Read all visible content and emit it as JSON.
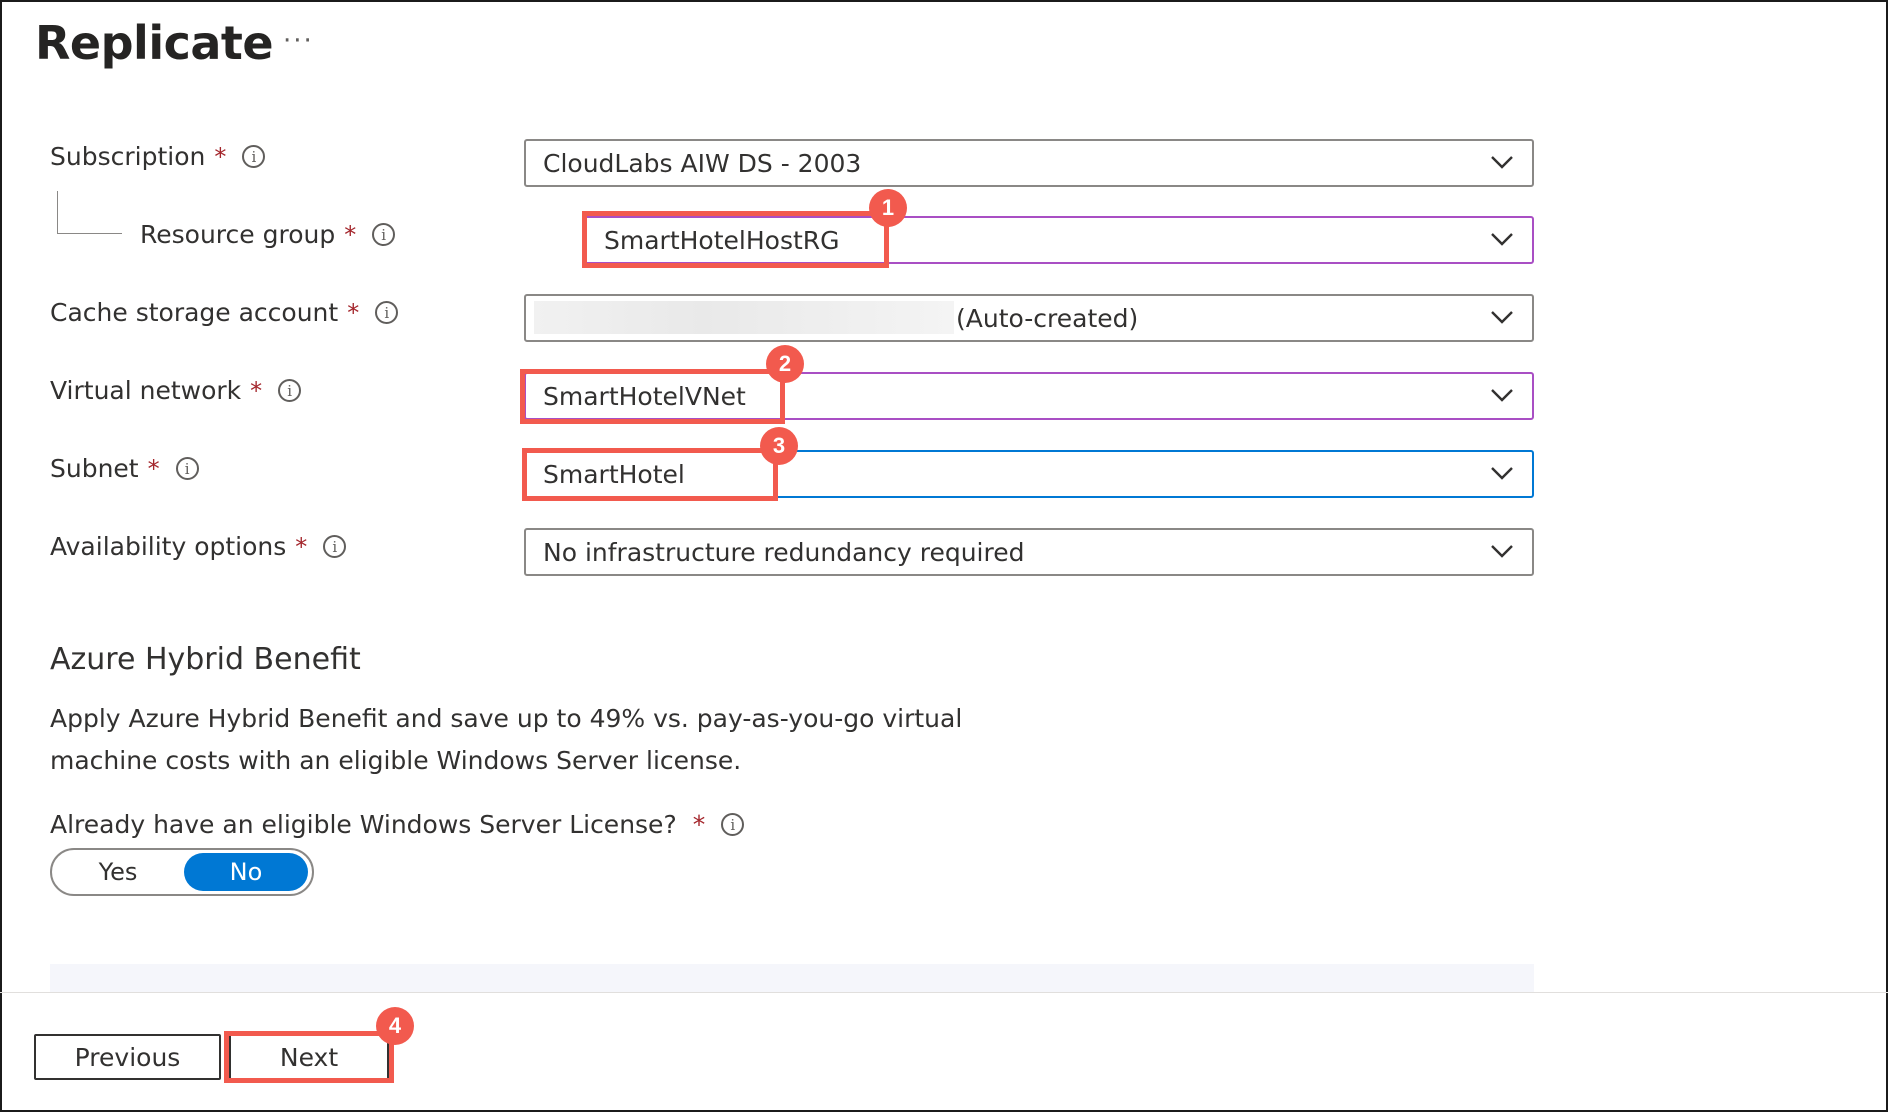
{
  "header": {
    "title": "Replicate",
    "more_label": "···"
  },
  "form": {
    "required_marker": "*",
    "info_glyph": "i",
    "fields": [
      {
        "label": "Subscription",
        "value": "CloudLabs AIW DS - 2003"
      },
      {
        "label": "Resource group",
        "value": "SmartHotelHostRG"
      },
      {
        "label": "Cache storage account",
        "value": "(Auto-created)"
      },
      {
        "label": "Virtual network",
        "value": "SmartHotelVNet"
      },
      {
        "label": "Subnet",
        "value": "SmartHotel"
      },
      {
        "label": "Availability options",
        "value": "No infrastructure redundancy required"
      }
    ]
  },
  "hybrid": {
    "title": "Azure Hybrid Benefit",
    "description": "Apply Azure Hybrid Benefit and save up to 49% vs. pay-as-you-go virtual machine costs with an eligible Windows Server license.",
    "question": "Already have an eligible Windows Server License?",
    "toggle": {
      "yes": "Yes",
      "no": "No",
      "selected": "No"
    }
  },
  "footer": {
    "previous_label": "Previous",
    "next_label": "Next"
  },
  "annotations": {
    "badge1": "1",
    "badge2": "2",
    "badge3": "3",
    "badge4": "4"
  },
  "colors": {
    "accent": "#0078d4",
    "highlight": "#f25a4e",
    "required": "#a4262c",
    "focus_purple": "#a94fc4"
  }
}
